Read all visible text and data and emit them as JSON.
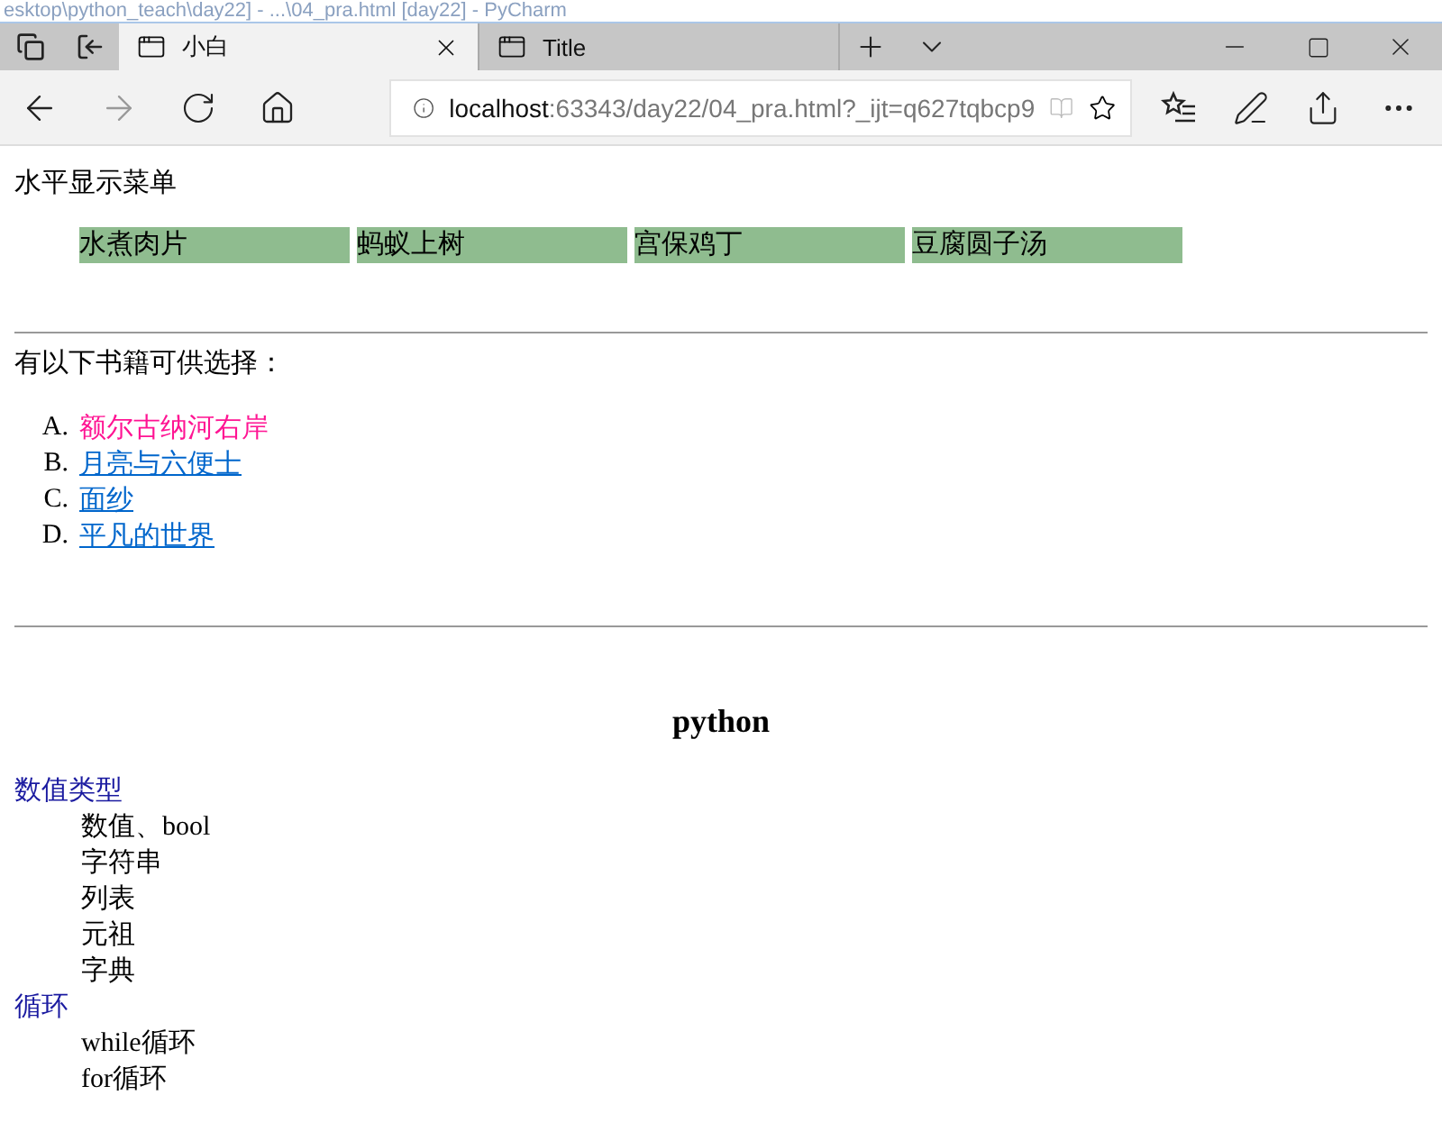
{
  "window": {
    "title": "esktop\\python_teach\\day22] - ...\\04_pra.html [day22] - PyCharm"
  },
  "tabs": [
    {
      "label": "小白",
      "selected": true
    },
    {
      "label": "Title",
      "selected": false
    }
  ],
  "address_bar": {
    "host": "localhost",
    "path": ":63343/day22/04_pra.html?_ijt=q627tqbcp9"
  },
  "page": {
    "menu_heading": "水平显示菜单",
    "menu_items": [
      "水煮肉片",
      "蚂蚁上树",
      "宫保鸡丁",
      "豆腐圆子汤"
    ],
    "books_heading": "有以下书籍可供选择：",
    "books": [
      {
        "marker": "A.",
        "title": "额尔古纳河右岸",
        "active": true
      },
      {
        "marker": "B.",
        "title": "月亮与六便士",
        "active": false
      },
      {
        "marker": "C.",
        "title": "面纱",
        "active": false
      },
      {
        "marker": "D.",
        "title": "平凡的世界",
        "active": false
      }
    ],
    "section_title": "python",
    "topics": [
      {
        "term": "数值类型",
        "items": [
          "数值、bool",
          "字符串",
          "列表",
          "元祖",
          "字典"
        ]
      },
      {
        "term": "循环",
        "items": [
          "while循环",
          "for循环"
        ]
      }
    ]
  }
}
